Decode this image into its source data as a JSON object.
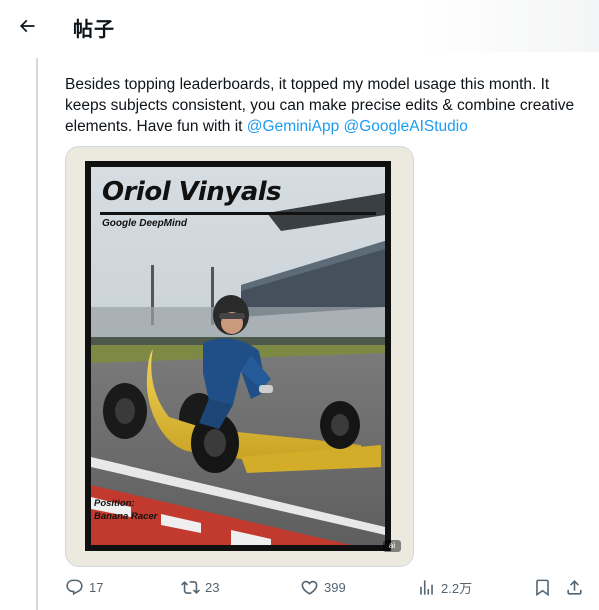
{
  "header": {
    "title": "帖子"
  },
  "tweet": {
    "text_parts": [
      "Besides topping leaderboards, it topped my model usage this month. It keeps subjects consistent, you can make precise edits & combine creative elements. Have fun with it ",
      " "
    ],
    "mentions": [
      "@GeminiApp",
      "@GoogleAIStudio"
    ]
  },
  "media": {
    "card_name": "Oriol Vinyals",
    "card_org": "Google DeepMind",
    "position_label": "Position:",
    "position_value": "Banana Racer",
    "badge": "ai"
  },
  "actions": {
    "reply_count": "17",
    "retweet_count": "23",
    "like_count": "399",
    "views_count": "2.2万"
  },
  "colors": {
    "accent": "#1d9bf0",
    "muted": "#536471",
    "border": "#cfd9de",
    "banana": "#e8c43a"
  },
  "icons": [
    "back-arrow-icon",
    "reply-icon",
    "retweet-icon",
    "like-icon",
    "views-icon",
    "bookmark-icon",
    "share-icon"
  ]
}
